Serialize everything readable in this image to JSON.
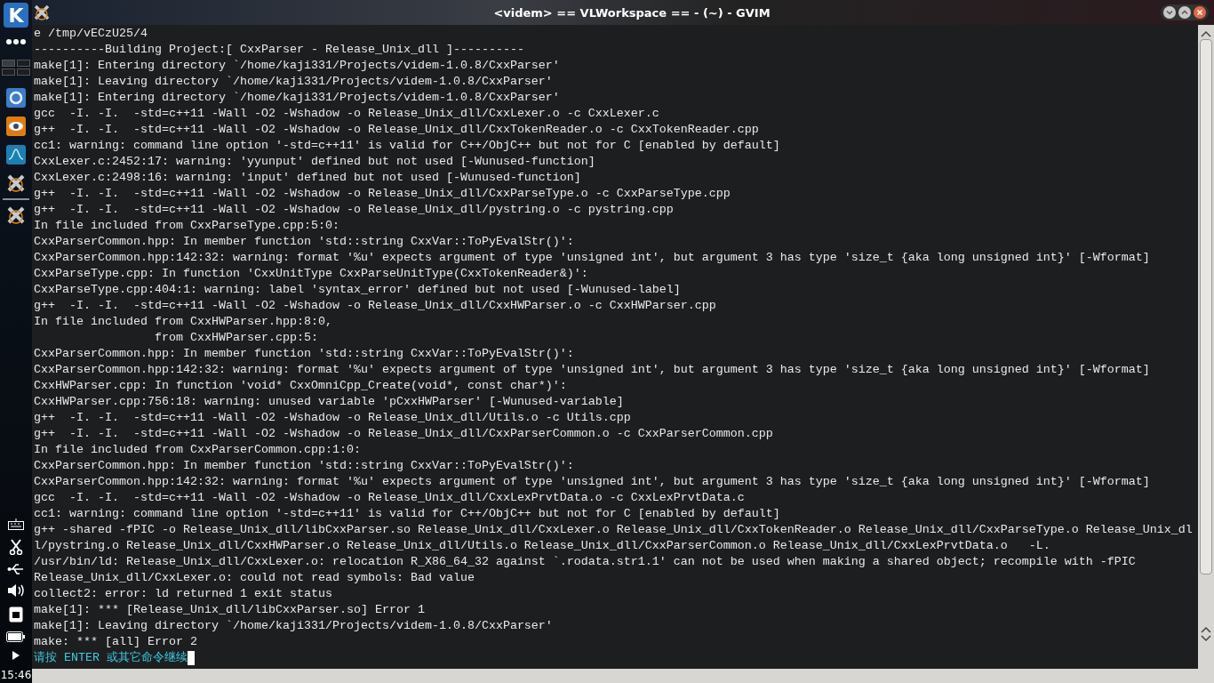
{
  "panel": {
    "launcher": "K",
    "clock": "15:46"
  },
  "window": {
    "title": "<videm> == VLWorkspace == - (~) - GVIM"
  },
  "buffer": {
    "lines": [
      "e /tmp/vECzU25/4",
      "----------Building Project:[ CxxParser - Release_Unix_dll ]----------",
      "make[1]: Entering directory `/home/kaji331/Projects/videm-1.0.8/CxxParser'",
      "make[1]: Leaving directory `/home/kaji331/Projects/videm-1.0.8/CxxParser'",
      "make[1]: Entering directory `/home/kaji331/Projects/videm-1.0.8/CxxParser'",
      "gcc  -I. -I.  -std=c++11 -Wall -O2 -Wshadow -o Release_Unix_dll/CxxLexer.o -c CxxLexer.c",
      "g++  -I. -I.  -std=c++11 -Wall -O2 -Wshadow -o Release_Unix_dll/CxxTokenReader.o -c CxxTokenReader.cpp",
      "cc1: warning: command line option '-std=c++11' is valid for C++/ObjC++ but not for C [enabled by default]",
      "CxxLexer.c:2452:17: warning: 'yyunput' defined but not used [-Wunused-function]",
      "CxxLexer.c:2498:16: warning: 'input' defined but not used [-Wunused-function]",
      "g++  -I. -I.  -std=c++11 -Wall -O2 -Wshadow -o Release_Unix_dll/CxxParseType.o -c CxxParseType.cpp",
      "g++  -I. -I.  -std=c++11 -Wall -O2 -Wshadow -o Release_Unix_dll/pystring.o -c pystring.cpp",
      "In file included from CxxParseType.cpp:5:0:",
      "CxxParserCommon.hpp: In member function 'std::string CxxVar::ToPyEvalStr()':",
      "CxxParserCommon.hpp:142:32: warning: format '%u' expects argument of type 'unsigned int', but argument 3 has type 'size_t {aka long unsigned int}' [-Wformat]",
      "CxxParseType.cpp: In function 'CxxUnitType CxxParseUnitType(CxxTokenReader&)':",
      "CxxParseType.cpp:404:1: warning: label 'syntax_error' defined but not used [-Wunused-label]",
      "g++  -I. -I.  -std=c++11 -Wall -O2 -Wshadow -o Release_Unix_dll/CxxHWParser.o -c CxxHWParser.cpp",
      "In file included from CxxHWParser.hpp:8:0,",
      "                 from CxxHWParser.cpp:5:",
      "CxxParserCommon.hpp: In member function 'std::string CxxVar::ToPyEvalStr()':",
      "CxxParserCommon.hpp:142:32: warning: format '%u' expects argument of type 'unsigned int', but argument 3 has type 'size_t {aka long unsigned int}' [-Wformat]",
      "CxxHWParser.cpp: In function 'void* CxxOmniCpp_Create(void*, const char*)':",
      "CxxHWParser.cpp:756:18: warning: unused variable 'pCxxHWParser' [-Wunused-variable]",
      "g++  -I. -I.  -std=c++11 -Wall -O2 -Wshadow -o Release_Unix_dll/Utils.o -c Utils.cpp",
      "g++  -I. -I.  -std=c++11 -Wall -O2 -Wshadow -o Release_Unix_dll/CxxParserCommon.o -c CxxParserCommon.cpp",
      "In file included from CxxParserCommon.cpp:1:0:",
      "CxxParserCommon.hpp: In member function 'std::string CxxVar::ToPyEvalStr()':",
      "CxxParserCommon.hpp:142:32: warning: format '%u' expects argument of type 'unsigned int', but argument 3 has type 'size_t {aka long unsigned int}' [-Wformat]",
      "gcc  -I. -I.  -std=c++11 -Wall -O2 -Wshadow -o Release_Unix_dll/CxxLexPrvtData.o -c CxxLexPrvtData.c",
      "cc1: warning: command line option '-std=c++11' is valid for C++/ObjC++ but not for C [enabled by default]",
      "g++ -shared -fPIC -o Release_Unix_dll/libCxxParser.so Release_Unix_dll/CxxLexer.o Release_Unix_dll/CxxTokenReader.o Release_Unix_dll/CxxParseType.o Release_Unix_dl",
      "l/pystring.o Release_Unix_dll/CxxHWParser.o Release_Unix_dll/Utils.o Release_Unix_dll/CxxParserCommon.o Release_Unix_dll/CxxLexPrvtData.o   -L.",
      "/usr/bin/ld: Release_Unix_dll/CxxLexer.o: relocation R_X86_64_32 against `.rodata.str1.1' can not be used when making a shared object; recompile with -fPIC",
      "Release_Unix_dll/CxxLexer.o: could not read symbols: Bad value",
      "collect2: error: ld returned 1 exit status",
      "make[1]: *** [Release_Unix_dll/libCxxParser.so] Error 1",
      "make[1]: Leaving directory `/home/kaji331/Projects/videm-1.0.8/CxxParser'",
      "make: *** [all] Error 2"
    ],
    "prompt": "请按 ENTER 或其它命令继续"
  }
}
